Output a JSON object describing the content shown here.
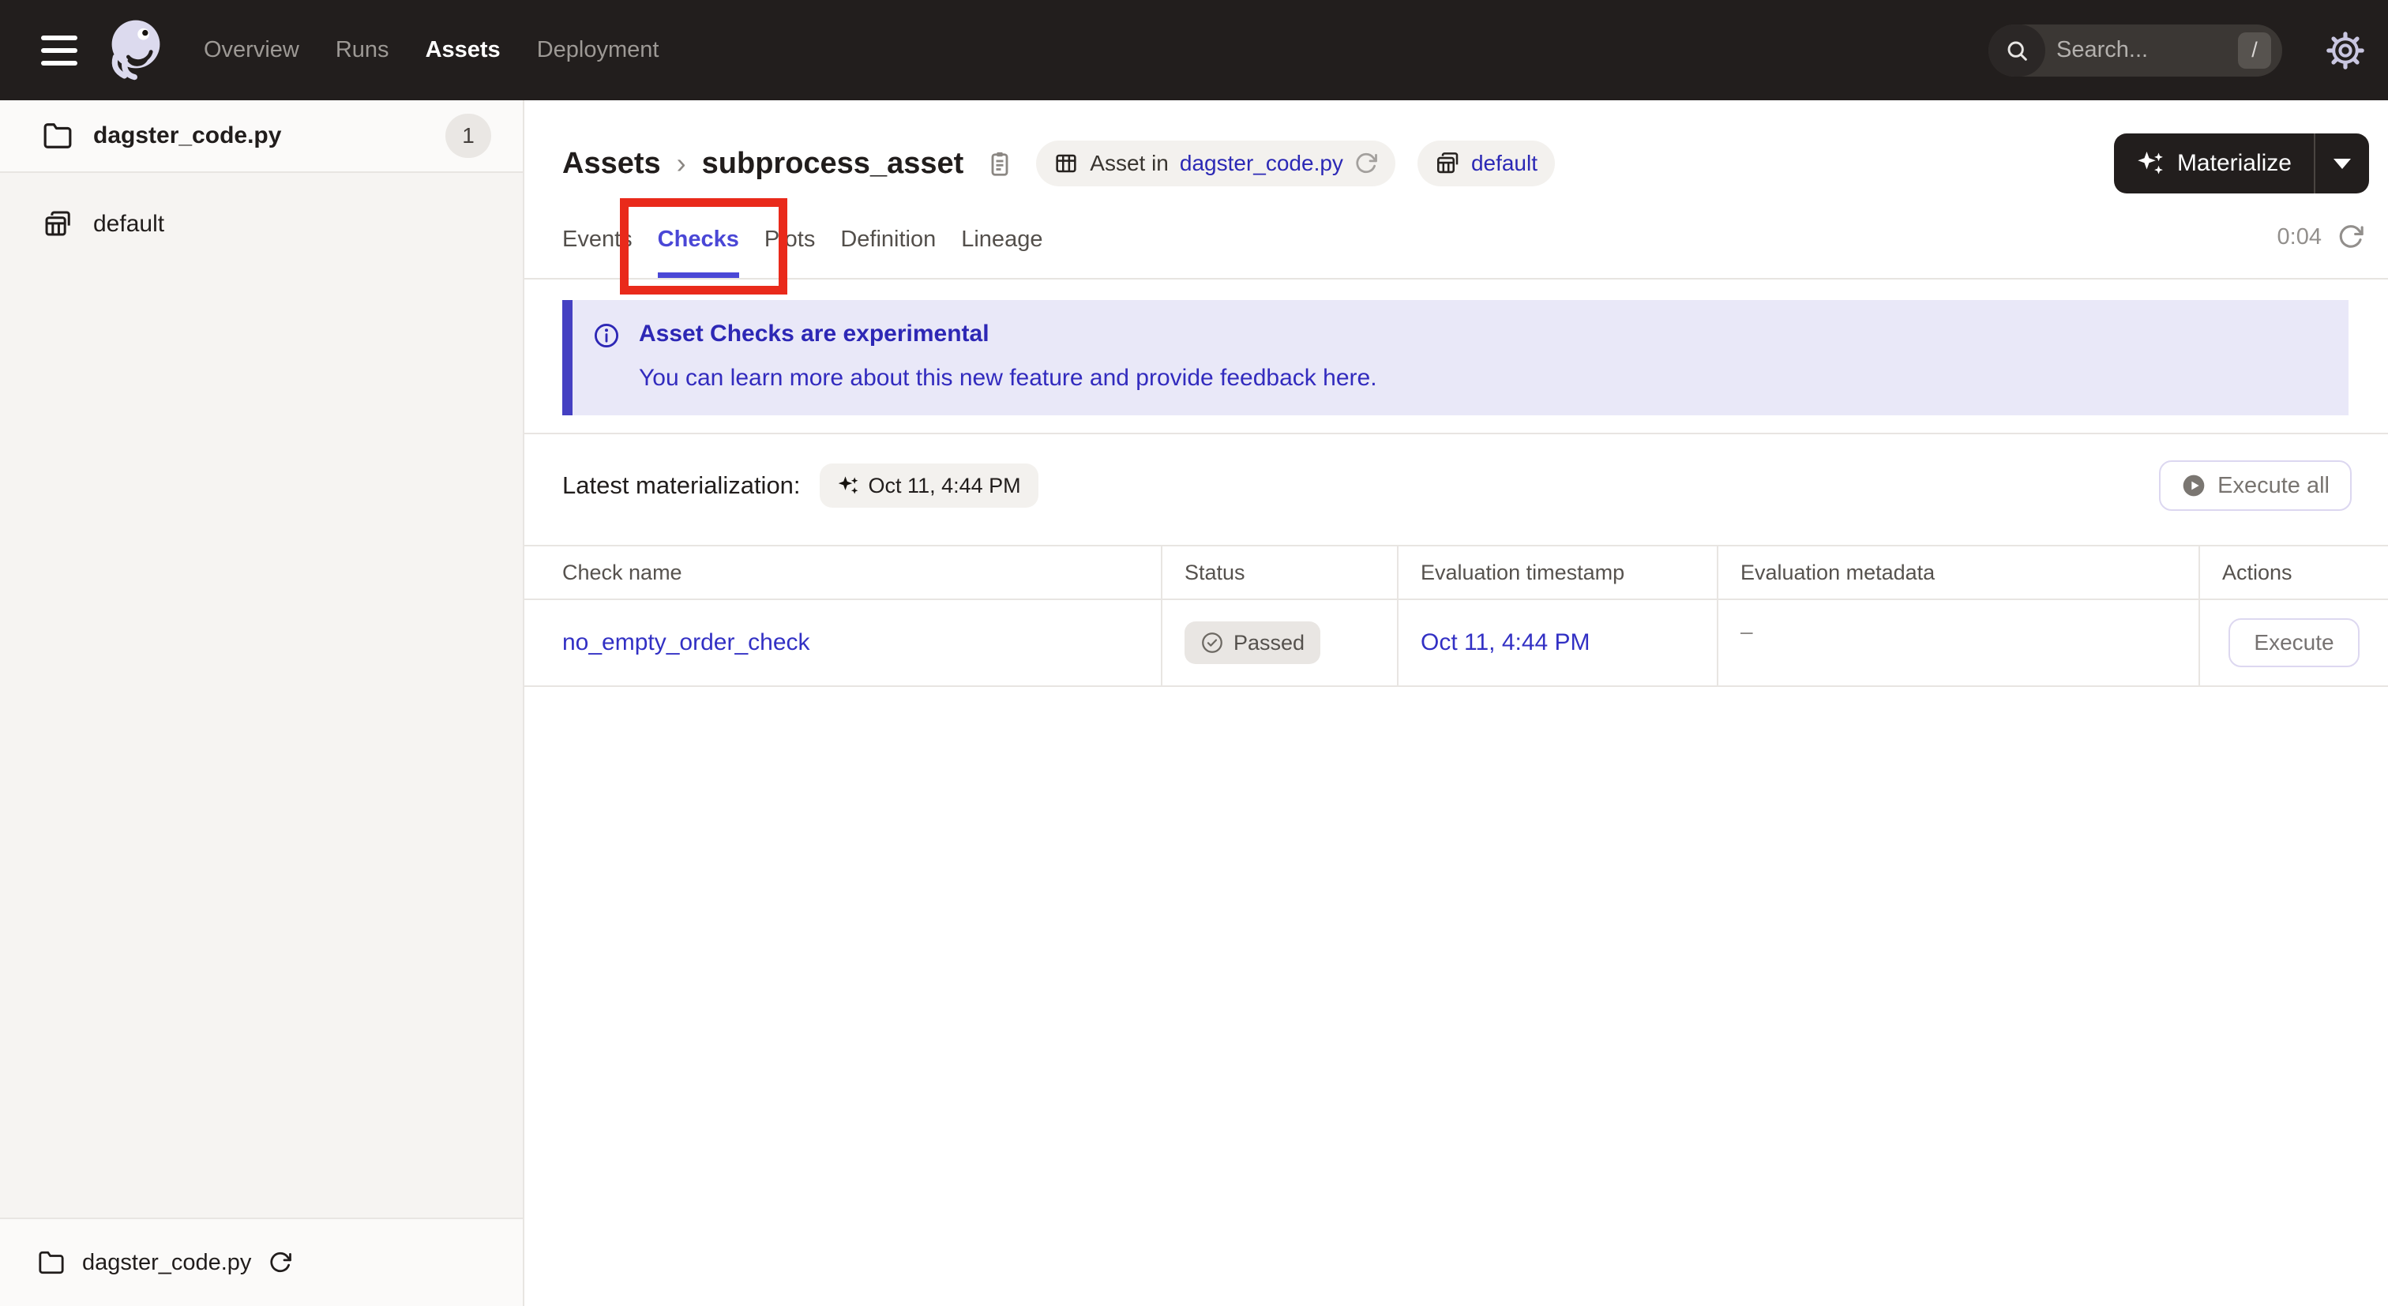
{
  "nav": {
    "menu_items": [
      {
        "label": "Overview"
      },
      {
        "label": "Runs"
      },
      {
        "label": "Assets"
      },
      {
        "label": "Deployment"
      }
    ],
    "active_item": "Assets",
    "search": {
      "placeholder": "Search...",
      "shortcut_key": "/"
    }
  },
  "sidebar": {
    "groups": [
      {
        "label": "dagster_code.py",
        "count": "1",
        "icon": "folder-icon"
      },
      {
        "label": "default",
        "icon": "asset-group-icon"
      }
    ],
    "footer": {
      "label": "dagster_code.py",
      "icon": "folder-icon"
    }
  },
  "header": {
    "breadcrumb": {
      "root": "Assets",
      "separator": "›",
      "current": "subprocess_asset"
    },
    "asset_tag": {
      "prefix": "Asset in",
      "link": "dagster_code.py"
    },
    "group_tag": {
      "label": "default"
    },
    "materialize": {
      "label": "Materialize"
    }
  },
  "tabs": {
    "items": [
      {
        "label": "Events"
      },
      {
        "label": "Checks"
      },
      {
        "label": "Plots"
      },
      {
        "label": "Definition"
      },
      {
        "label": "Lineage"
      }
    ],
    "active": "Checks",
    "timer": "0:04"
  },
  "banner": {
    "title": "Asset Checks are experimental",
    "body": "You can learn more about this new feature and provide feedback ",
    "link_text": "here",
    "suffix": "."
  },
  "materialization": {
    "label": "Latest materialization:",
    "timestamp": "Oct 11, 4:44 PM",
    "execute_all_label": "Execute all"
  },
  "checks_table": {
    "headers": [
      {
        "label": "Check name"
      },
      {
        "label": "Status"
      },
      {
        "label": "Evaluation timestamp"
      },
      {
        "label": "Evaluation metadata"
      },
      {
        "label": "Actions"
      }
    ],
    "rows": [
      {
        "name": "no_empty_order_check",
        "status": "Passed",
        "timestamp": "Oct 11, 4:44 PM",
        "metadata": "–",
        "action_label": "Execute"
      }
    ]
  },
  "colors": {
    "nav_bg": "#221e1d",
    "accent_indigo": "#4a47d6",
    "link_blue": "#3230c4",
    "banner_bg": "#e9e8f8",
    "annotation_red": "#e92a1b"
  }
}
